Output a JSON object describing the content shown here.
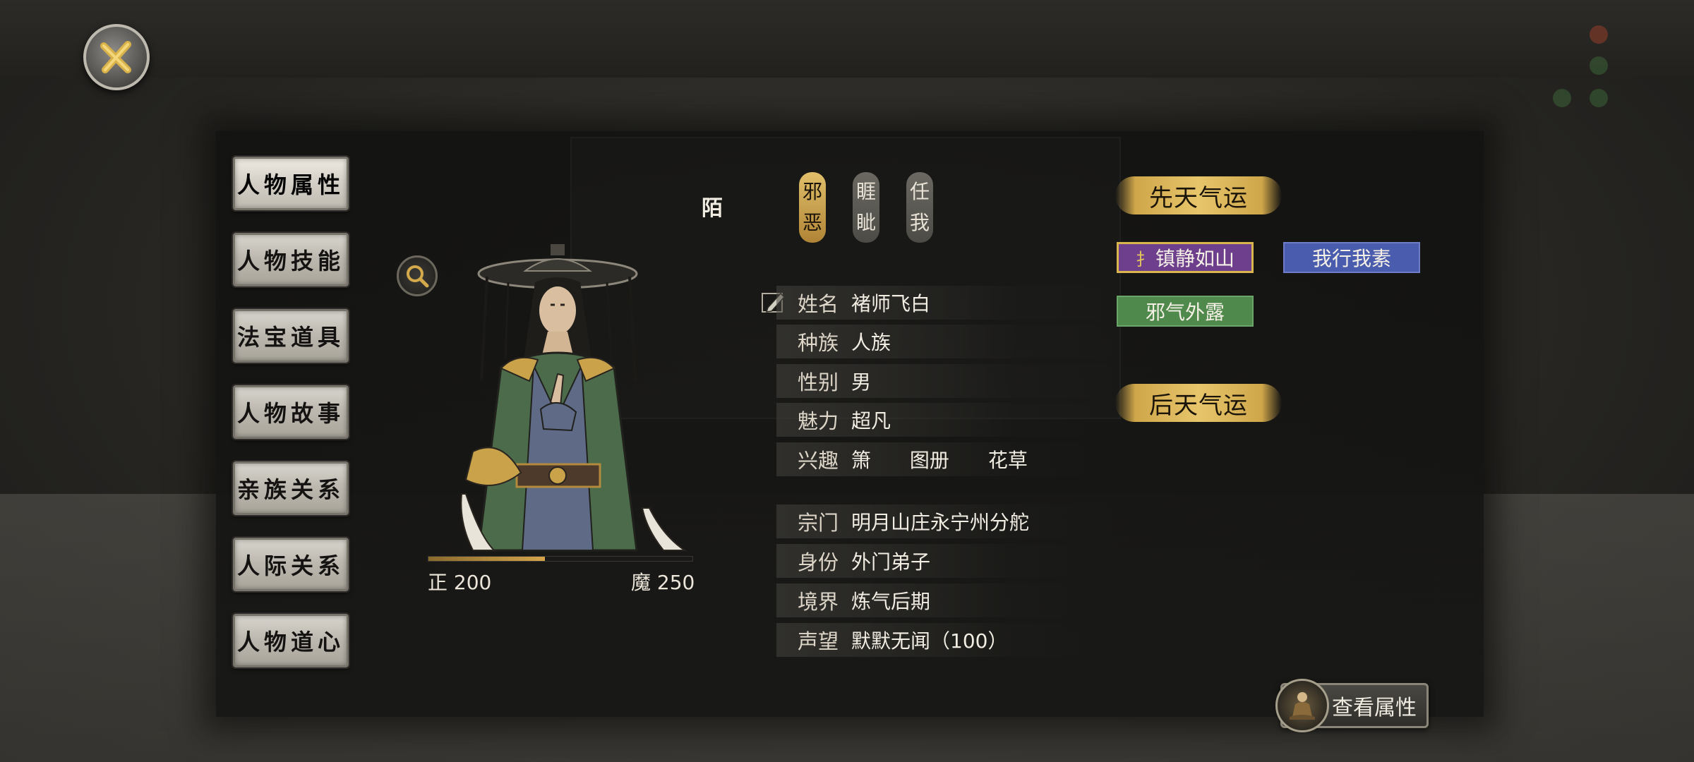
{
  "close": {
    "icon": "close-x-icon"
  },
  "menu": {
    "items": [
      {
        "label": "人物属性",
        "active": true
      },
      {
        "label": "人物技能",
        "active": false
      },
      {
        "label": "法宝道具",
        "active": false
      },
      {
        "label": "人物故事",
        "active": false
      },
      {
        "label": "亲族关系",
        "active": false
      },
      {
        "label": "人际关系",
        "active": false
      },
      {
        "label": "人物道心",
        "active": false
      }
    ]
  },
  "character": {
    "mark": "陌",
    "tags": [
      {
        "text": "邪恶",
        "style": "gold"
      },
      {
        "text": "睚眦",
        "style": "grey"
      },
      {
        "text": "任我",
        "style": "grey"
      }
    ],
    "morality": {
      "righteous_label": "正 200",
      "demonic_label": "魔 250",
      "righteous_fraction": 0.44
    }
  },
  "attributes": {
    "name_key": "姓名",
    "name_val": "褚师飞白",
    "race_key": "种族",
    "race_val": "人族",
    "gender_key": "性别",
    "gender_val": "男",
    "charm_key": "魅力",
    "charm_val": "超凡",
    "hobby_key": "兴趣",
    "hobbies": [
      "箫",
      "图册",
      "花草"
    ],
    "sect_key": "宗门",
    "sect_val": "明月山庄永宁州分舵",
    "identity_key": "身份",
    "identity_val": "外门弟子",
    "realm_key": "境界",
    "realm_val": "炼气后期",
    "fame_key": "声望",
    "fame_val": "默默无闻（100）"
  },
  "fortune": {
    "innate_title": "先天气运",
    "innate_traits": [
      {
        "label": "镇静如山",
        "color": "#6d3f8d"
      },
      {
        "label": "我行我素",
        "color": "#4a5cae"
      },
      {
        "label": "邪气外露",
        "color": "#4f8a4c"
      }
    ],
    "acquired_title": "后天气运"
  },
  "view_button": {
    "label": "查看属性"
  },
  "colors": {
    "accent_gold": "#e0bf6a",
    "panel": "#141413"
  }
}
